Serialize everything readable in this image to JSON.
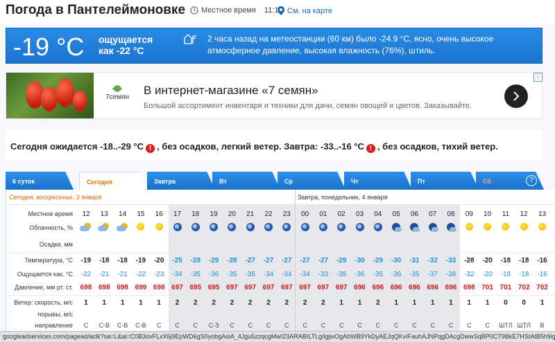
{
  "header": {
    "title": "Погода в Пантелеймоновке",
    "local_time_label": "Местное время",
    "local_time": "11:14",
    "map_link": "См. на карте"
  },
  "now": {
    "temp": "-19 °C",
    "feels_line1": "ощущается",
    "feels_line2": "как -22 °C",
    "station_text": "2 часа назад на метеостанции (60 км) было -24.9 °C, ясно, очень высокое атмосферное давление, высокая влажность (76%), штиль."
  },
  "ad": {
    "logo_text": "7семян",
    "title": "В интернет-магазине «7 семян»",
    "subtitle": "Большой ассортимент инвентаря и техники для дачи, семян овощей и цветов. Заказывайте."
  },
  "forecast_summary": {
    "part1": "Сегодня ожидается -18..-29 °C",
    "part2": ", без осадков, легкий ветер. Завтра: -33..-16 °C",
    "part3": ", без осадков, тихий ветер."
  },
  "tabs": [
    {
      "label": "6 суток"
    },
    {
      "label": "Сегодня"
    },
    {
      "label": "Завтра"
    },
    {
      "label": "Вт"
    },
    {
      "label": "Ср"
    },
    {
      "label": "Чт"
    },
    {
      "label": "Пт"
    },
    {
      "label": "Сб"
    }
  ],
  "help_label": "?",
  "day_labels": {
    "today": "Сегодня, воскресенье, 3 января",
    "tomorrow": "Завтра, понедельник, 4 января"
  },
  "row_labels": {
    "time": "Местное время",
    "cloud": "Облачность, %",
    "precip": "Осадки, мм",
    "temp": "Температура, °C",
    "feels": "Ощущается как, °C",
    "pressure": "Давление, мм рт. ст.",
    "wind": "Ветер: скорость, м/с",
    "gusts": "порывы, м/с",
    "direction": "направление"
  },
  "hours": [
    "12",
    "13",
    "14",
    "15",
    "16",
    "17",
    "18",
    "19",
    "20",
    "21",
    "22",
    "23",
    "00",
    "01",
    "02",
    "03",
    "04",
    "05",
    "06",
    "07",
    "08",
    "09",
    "10",
    "11",
    "12",
    "13"
  ],
  "icons": [
    "cloudy",
    "cloudy",
    "cloudy",
    "sun",
    "sun",
    "moon",
    "moon",
    "moon",
    "moon",
    "moon",
    "moon",
    "moon",
    "moon",
    "moon",
    "moon",
    "moon",
    "moon",
    "mooncloud",
    "mooncloud",
    "mooncloud",
    "mooncloud",
    "sun",
    "sun",
    "sun",
    "sun",
    "sun"
  ],
  "temps": [
    "-19",
    "-18",
    "-18",
    "-19",
    "-20",
    "-25",
    "-28",
    "-29",
    "-28",
    "-27",
    "-27",
    "-27",
    "-27",
    "-27",
    "-29",
    "-30",
    "-29",
    "-30",
    "-31",
    "-32",
    "-33",
    "-28",
    "-20",
    "-18",
    "-18",
    "-16"
  ],
  "feels": [
    "-22",
    "-21",
    "-21",
    "-22",
    "-23",
    "-34",
    "-35",
    "-36",
    "-35",
    "-35",
    "-34",
    "-34",
    "-34",
    "-33",
    "-35",
    "-36",
    "-35",
    "-36",
    "-35",
    "-37",
    "-38",
    "-32",
    "-20",
    "-18",
    "-18",
    "-16"
  ],
  "pressure": [
    "698",
    "698",
    "698",
    "699",
    "698",
    "697",
    "695",
    "695",
    "697",
    "697",
    "697",
    "697",
    "697",
    "697",
    "697",
    "696",
    "696",
    "696",
    "696",
    "696",
    "696",
    "698",
    "701",
    "701",
    "702",
    "702"
  ],
  "wind": [
    "1",
    "1",
    "1",
    "1",
    "1",
    "2",
    "2",
    "2",
    "2",
    "2",
    "2",
    "2",
    "2",
    "2",
    "1",
    "1",
    "2",
    "1",
    "1",
    "1",
    "1",
    "1",
    "1",
    "0",
    "0",
    "1"
  ],
  "direction": [
    "С",
    "С-В",
    "С-В",
    "С-В",
    "С",
    "С",
    "С",
    "С-З",
    "С",
    "С",
    "С",
    "С",
    "С",
    "С",
    "С",
    "С",
    "С",
    "С",
    "С",
    "С",
    "С",
    "С",
    "С",
    "ШТЛ",
    "ШТЛ",
    "В"
  ],
  "status_url": "googleadservices.com/pagead/aclk?sa=L&ai=C0B3ovFLxX6j9EpWD6gS0yobgAsiA_4Jgu5zzqcgMwI23ARABILTLgiIgjwOgAbWB9YkDyAEJqQKvIFauhAJNPqgDAcgDwwSqBP0CT9BkE7HStAtB5h9igUMe"
}
